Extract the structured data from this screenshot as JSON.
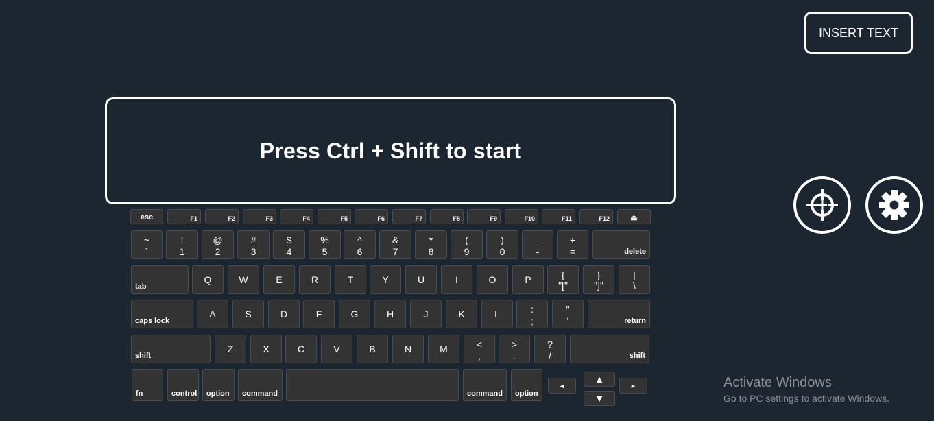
{
  "header": {
    "insert_text_label": "INSERT TEXT"
  },
  "prompt": {
    "text": "Press Ctrl + Shift to start"
  },
  "watermark": {
    "title": "Activate Windows",
    "subtitle": "Go to PC settings to activate Windows."
  },
  "icons": {
    "add": "crosshair-plus-icon",
    "settings": "gear-icon"
  },
  "keyboard": {
    "fn_row": [
      "esc",
      "F1",
      "F2",
      "F3",
      "F4",
      "F5",
      "F6",
      "F7",
      "F8",
      "F9",
      "F10",
      "F11",
      "F12",
      "⏏"
    ],
    "number_row": [
      {
        "upper": "~",
        "lower": "`"
      },
      {
        "upper": "!",
        "lower": "1"
      },
      {
        "upper": "@",
        "lower": "2"
      },
      {
        "upper": "#",
        "lower": "3"
      },
      {
        "upper": "$",
        "lower": "4"
      },
      {
        "upper": "%",
        "lower": "5"
      },
      {
        "upper": "^",
        "lower": "6"
      },
      {
        "upper": "&",
        "lower": "7"
      },
      {
        "upper": "*",
        "lower": "8"
      },
      {
        "upper": "(",
        "lower": "9"
      },
      {
        "upper": ")",
        "lower": "0"
      },
      {
        "upper": "_",
        "lower": "-"
      },
      {
        "upper": "+",
        "lower": "="
      }
    ],
    "delete_label": "delete",
    "tab_label": "tab",
    "qwerty_row": [
      "Q",
      "W",
      "E",
      "R",
      "T",
      "Y",
      "U",
      "I",
      "O",
      "P"
    ],
    "qwerty_extra": [
      {
        "upper": "{",
        "lower": "\"[\""
      },
      {
        "upper": "}",
        "lower": "\"]\""
      },
      {
        "upper": "|",
        "lower": "\\"
      }
    ],
    "caps_label": "caps lock",
    "home_row": [
      "A",
      "S",
      "D",
      "F",
      "G",
      "H",
      "J",
      "K",
      "L"
    ],
    "home_extra": [
      {
        "upper": ":",
        "lower": ";"
      },
      {
        "upper": "\"",
        "lower": "'"
      }
    ],
    "return_label": "return",
    "shift_label": "shift",
    "bottom_letters": [
      "Z",
      "X",
      "C",
      "V",
      "B",
      "N",
      "M"
    ],
    "bottom_extra": [
      {
        "upper": "<",
        "lower": ","
      },
      {
        "upper": ">",
        "lower": "."
      },
      {
        "upper": "?",
        "lower": "/"
      }
    ],
    "modifiers": {
      "fn": "fn",
      "control": "control",
      "option": "option",
      "command": "command"
    },
    "arrows": {
      "left": "◄",
      "up": "▲",
      "down": "▼",
      "right": "►"
    }
  }
}
